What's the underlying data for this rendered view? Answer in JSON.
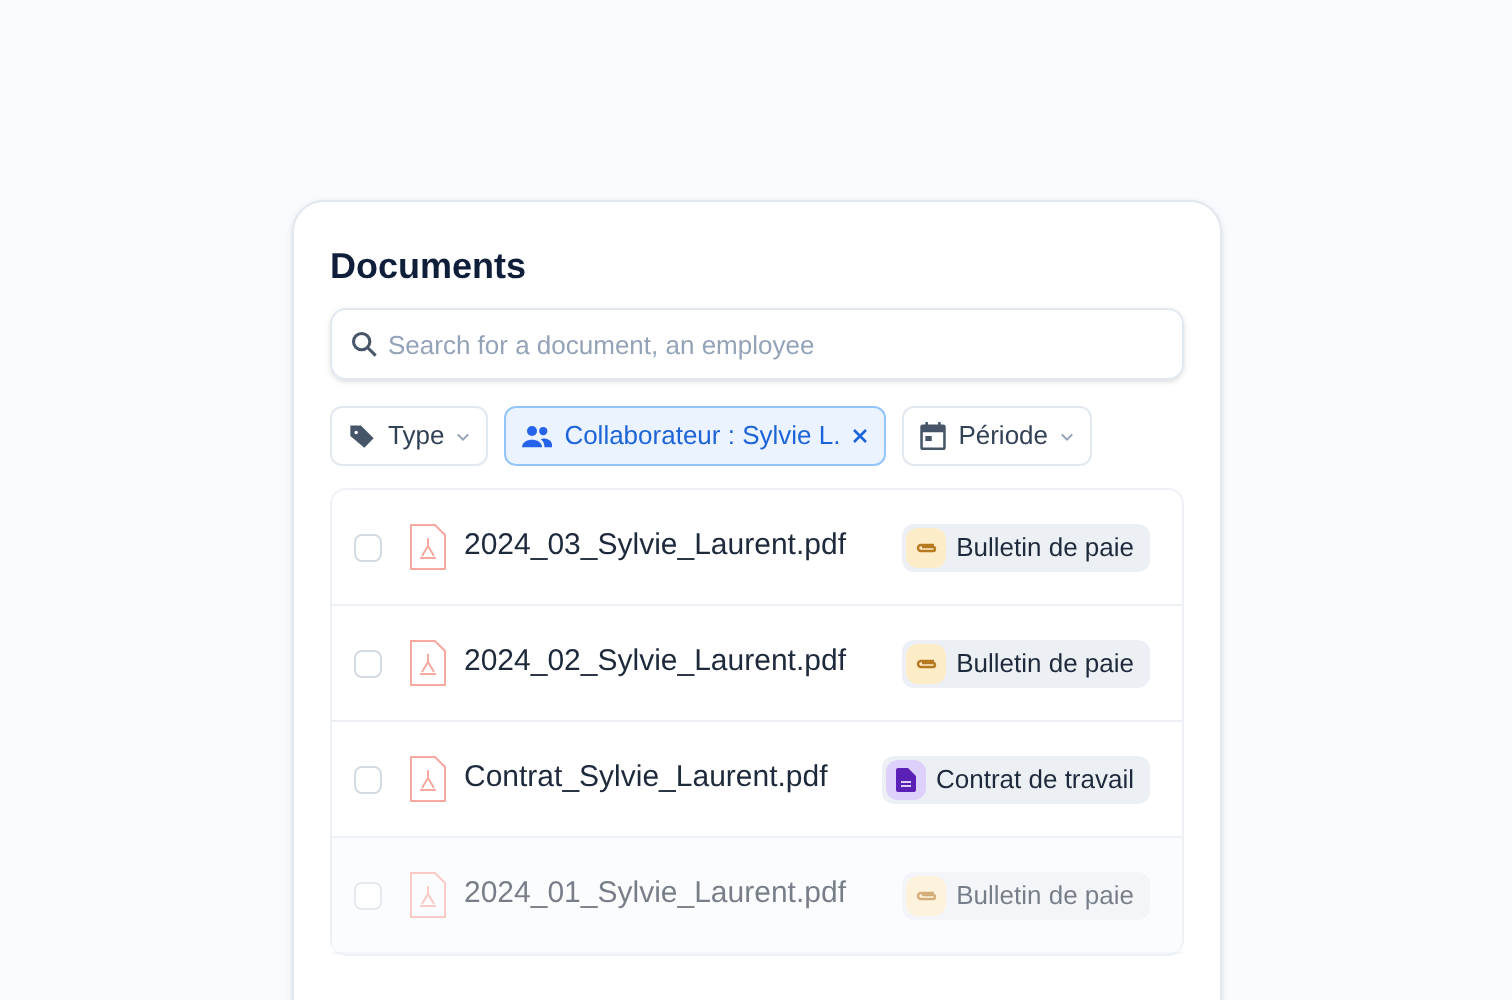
{
  "title": "Documents",
  "search": {
    "placeholder": "Search for a document, an employee"
  },
  "filters": [
    {
      "kind": "type",
      "label": "Type",
      "active": false
    },
    {
      "kind": "people",
      "label": "Collaborateur : Sylvie L.",
      "active": true
    },
    {
      "kind": "period",
      "label": "Période",
      "active": false
    }
  ],
  "documents": [
    {
      "name": "2024_03_Sylvie_Laurent.pdf",
      "checked": false,
      "faded": false,
      "tag": {
        "kind": "payslip",
        "label": "Bulletin de paie"
      }
    },
    {
      "name": "2024_02_Sylvie_Laurent.pdf",
      "checked": false,
      "faded": false,
      "tag": {
        "kind": "payslip",
        "label": "Bulletin de paie"
      }
    },
    {
      "name": "Contrat_Sylvie_Laurent.pdf",
      "checked": false,
      "faded": false,
      "tag": {
        "kind": "contract",
        "label": "Contrat de travail"
      }
    },
    {
      "name": "2024_01_Sylvie_Laurent.pdf",
      "checked": false,
      "faded": true,
      "tag": {
        "kind": "payslip",
        "label": "Bulletin de paie"
      }
    }
  ]
}
